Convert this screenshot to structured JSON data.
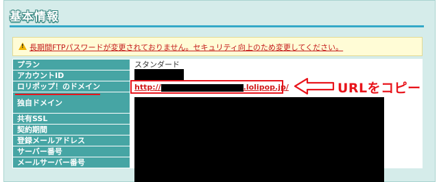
{
  "panel": {
    "title": "基本情報"
  },
  "warning": {
    "icon": "warning-icon",
    "text": "長期間FTPパスワードが変更されておりません。セキュリティ向上のため変更してください。"
  },
  "table": {
    "rows": [
      {
        "label": "プラン",
        "value": "スタンダード"
      },
      {
        "label": "アカウントID",
        "value": ""
      },
      {
        "label": "ロリポップ！のドメイン",
        "value_prefix": "http://",
        "value_suffix": ".lolipop.jp/"
      },
      {
        "label": "独自ドメイン",
        "value": ""
      },
      {
        "label": "共有SSL",
        "value": ""
      },
      {
        "label": "契約期間",
        "value": ""
      },
      {
        "label": "登録メールアドレス",
        "value": ""
      },
      {
        "label": "サーバー番号",
        "value": ""
      },
      {
        "label": "メールサーバー番号",
        "value": ""
      }
    ]
  },
  "annotation": {
    "copy_label": "URLをコピー",
    "accent_color": "#e8141b"
  },
  "colors": {
    "panel_bg": "#d5ecea",
    "label_bg": "#46a5a4",
    "warning_bg": "#fffcd6",
    "warning_text": "#c41a1a"
  }
}
